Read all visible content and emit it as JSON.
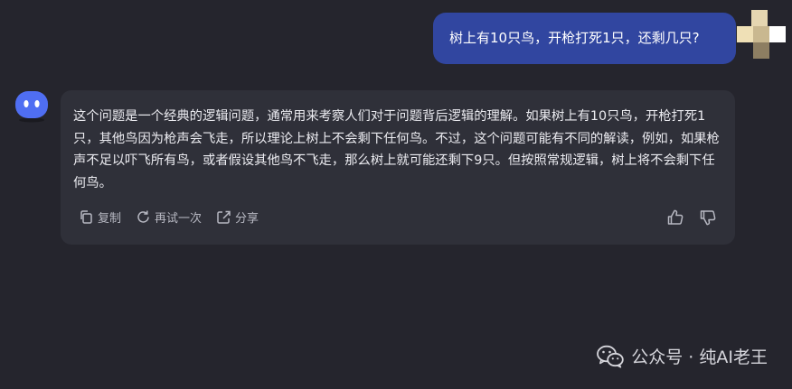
{
  "user": {
    "message": "树上有10只鸟，开枪打死1只，还剩几只?"
  },
  "assistant": {
    "message": "这个问题是一个经典的逻辑问题，通常用来考察人们对于问题背后逻辑的理解。如果树上有10只鸟，开枪打死1只，其他鸟因为枪声会飞走，所以理论上树上不会剩下任何鸟。不过，这个问题可能有不同的解读，例如，如果枪声不足以吓飞所有鸟，或者假设其他鸟不飞走，那么树上就可能还剩下9只。但按照常规逻辑，树上将不会剩下任何鸟。",
    "actions": {
      "copy": "复制",
      "retry": "再试一次",
      "share": "分享"
    }
  },
  "watermark": {
    "text": "公众号 · 纯AI老王"
  },
  "colors": {
    "background": "#25252d",
    "user_bubble": "#3146a0",
    "assistant_card": "#2f3039",
    "bot_avatar": "#4f6ef2"
  }
}
